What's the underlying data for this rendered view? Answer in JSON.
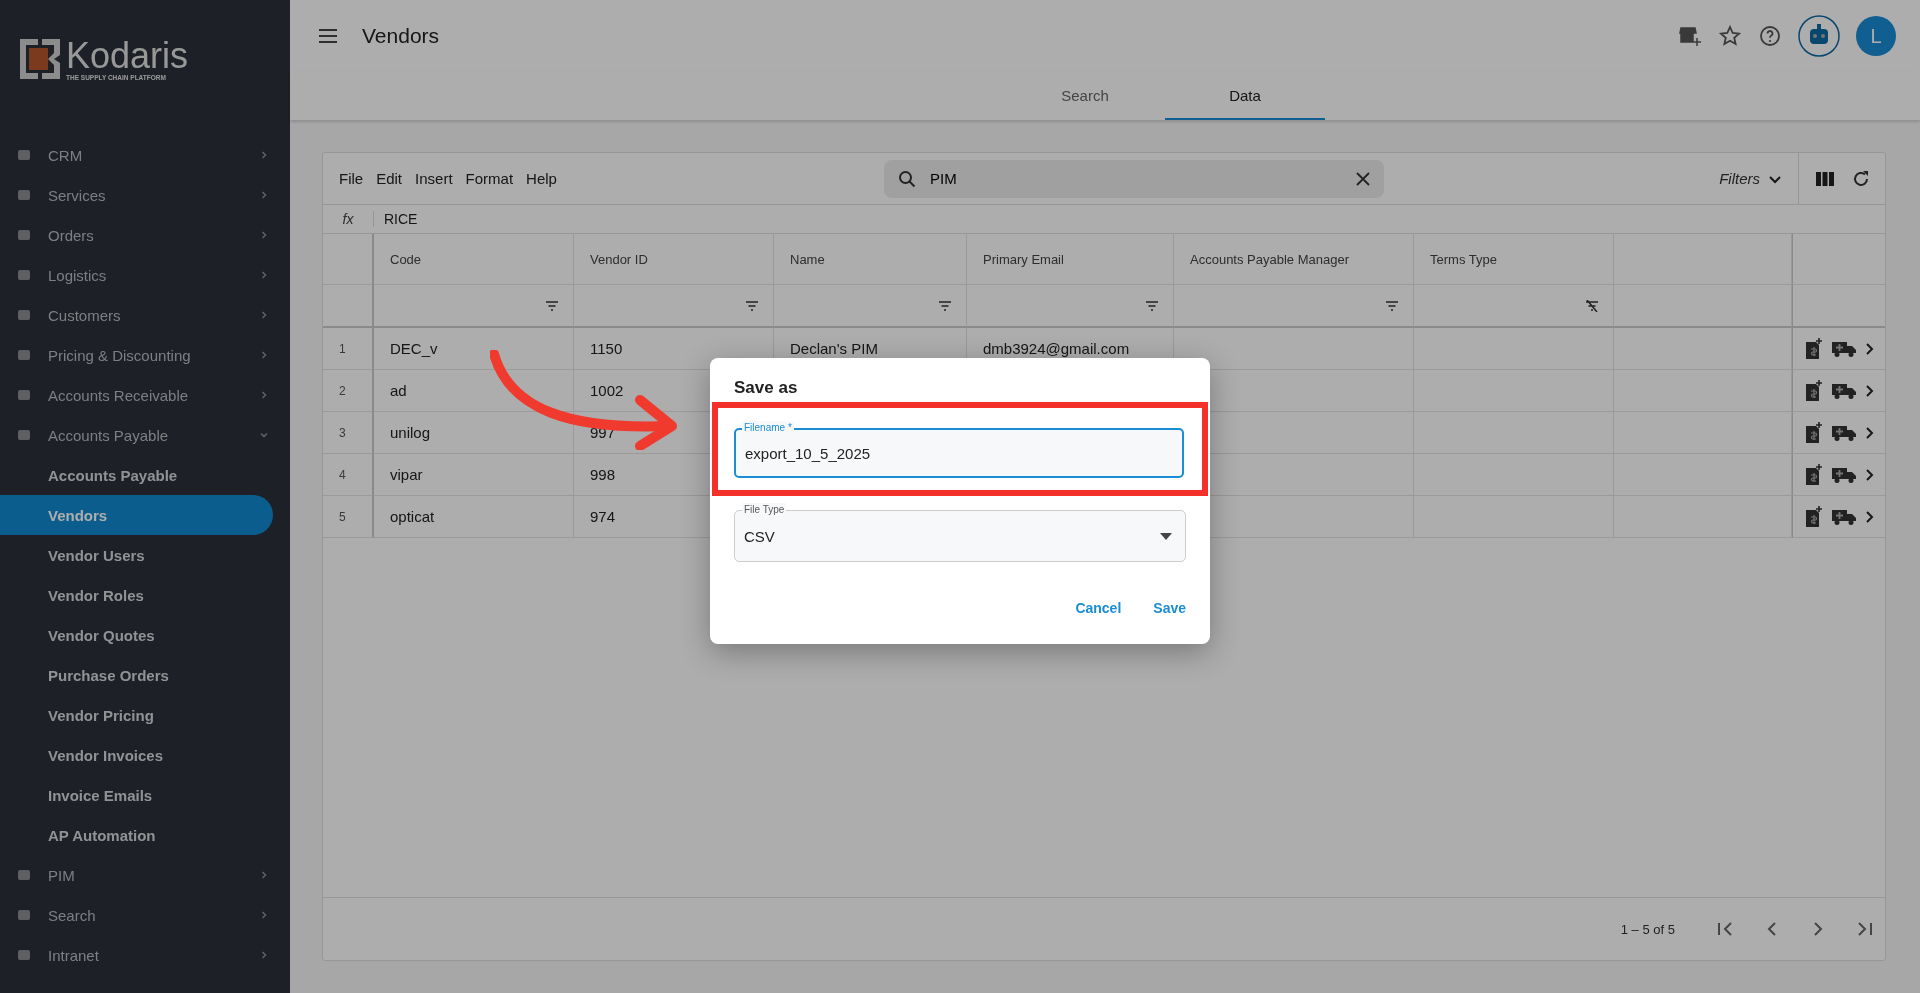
{
  "sidebar": {
    "logo": {
      "name": "Kodaris",
      "tagline": "THE SUPPLY CHAIN PLATFORM"
    },
    "items": [
      {
        "label": "CRM",
        "expanded": false
      },
      {
        "label": "Services",
        "expanded": false
      },
      {
        "label": "Orders",
        "expanded": false
      },
      {
        "label": "Logistics",
        "expanded": false
      },
      {
        "label": "Customers",
        "expanded": false
      },
      {
        "label": "Pricing & Discounting",
        "expanded": false
      },
      {
        "label": "Accounts Receivable",
        "expanded": false
      },
      {
        "label": "Accounts Payable",
        "expanded": true,
        "children": [
          {
            "label": "Accounts Payable",
            "selected": false
          },
          {
            "label": "Vendors",
            "selected": true
          },
          {
            "label": "Vendor Users",
            "selected": false
          },
          {
            "label": "Vendor Roles",
            "selected": false
          },
          {
            "label": "Vendor Quotes",
            "selected": false
          },
          {
            "label": "Purchase Orders",
            "selected": false
          },
          {
            "label": "Vendor Pricing",
            "selected": false
          },
          {
            "label": "Vendor Invoices",
            "selected": false
          },
          {
            "label": "Invoice Emails",
            "selected": false
          },
          {
            "label": "AP Automation",
            "selected": false
          }
        ]
      },
      {
        "label": "PIM",
        "expanded": false
      },
      {
        "label": "Search",
        "expanded": false
      },
      {
        "label": "Intranet",
        "expanded": false
      }
    ]
  },
  "header": {
    "title": "Vendors",
    "avatar": "L"
  },
  "tabs": [
    {
      "label": "Search",
      "selected": false
    },
    {
      "label": "Data",
      "selected": true
    }
  ],
  "toolbar": {
    "menu": [
      "File",
      "Edit",
      "Insert",
      "Format",
      "Help"
    ],
    "search": {
      "value": "PIM"
    },
    "filters": "Filters"
  },
  "formula_bar": {
    "label": "fx",
    "value": "RICE"
  },
  "table": {
    "columns": [
      "Code",
      "Vendor ID",
      "Name",
      "Primary Email",
      "Accounts Payable Manager",
      "Terms Type"
    ],
    "rows": [
      {
        "number": "1",
        "cells": [
          "DEC_v",
          "1150",
          "Declan's PIM",
          "dmb3924@gmail.com",
          "",
          ""
        ]
      },
      {
        "number": "2",
        "cells": [
          "ad",
          "1002",
          "",
          "",
          "",
          ""
        ]
      },
      {
        "number": "3",
        "cells": [
          "unilog",
          "997",
          "",
          "",
          "",
          ""
        ]
      },
      {
        "number": "4",
        "cells": [
          "vipar",
          "998",
          "",
          "",
          "",
          ""
        ]
      },
      {
        "number": "5",
        "cells": [
          "opticat",
          "974",
          "",
          "",
          "",
          ""
        ]
      }
    ]
  },
  "pagination": {
    "range": "1 – 5 of 5"
  },
  "dialog": {
    "title": "Save as",
    "filename": {
      "label": "Filename *",
      "value": "export_10_5_2025"
    },
    "file_type": {
      "label": "File Type",
      "value": "CSV"
    },
    "buttons": [
      "Cancel",
      "Save"
    ]
  }
}
